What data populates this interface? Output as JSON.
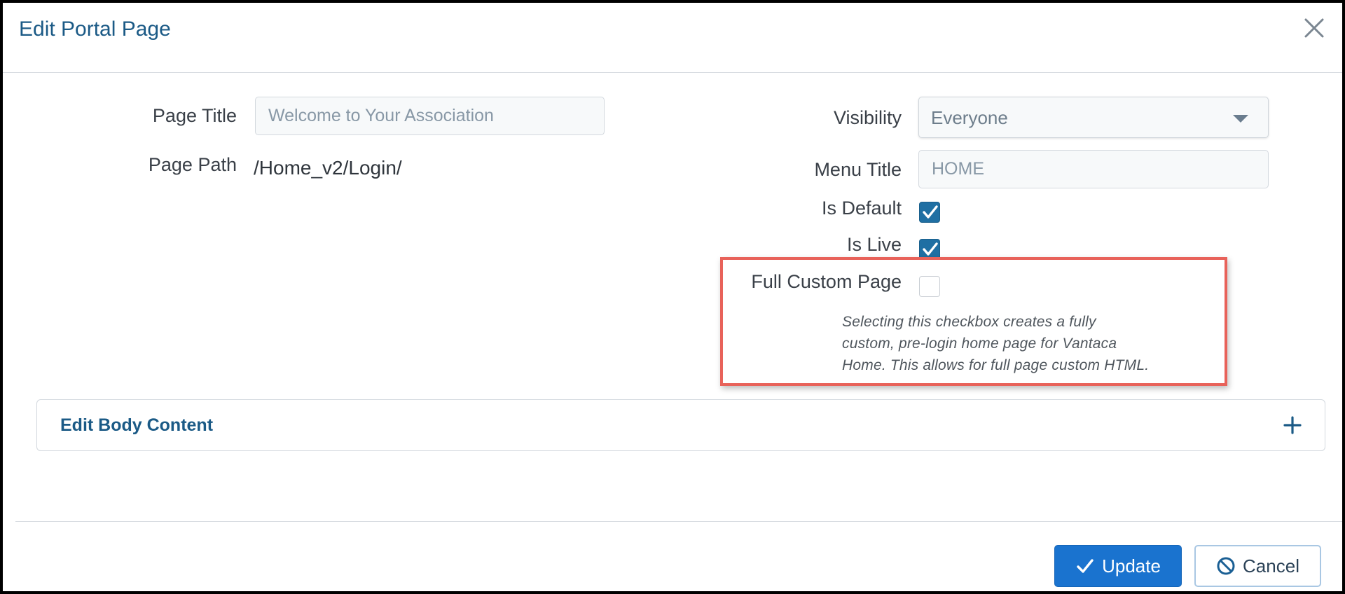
{
  "modal": {
    "title": "Edit Portal Page"
  },
  "form": {
    "page_title": {
      "label": "Page Title",
      "placeholder": "Welcome to Your Association"
    },
    "page_path": {
      "label": "Page Path",
      "value": "/Home_v2/Login/"
    },
    "visibility": {
      "label": "Visibility",
      "selected": "Everyone"
    },
    "menu_title": {
      "label": "Menu Title",
      "placeholder": "HOME"
    },
    "is_default": {
      "label": "Is Default",
      "checked": true
    },
    "is_live": {
      "label": "Is Live",
      "checked": true
    },
    "full_custom_page": {
      "label": "Full Custom Page",
      "checked": false,
      "help_line_1": "Selecting this checkbox creates a fully",
      "help_line_2": "custom, pre-login home page for Vantaca",
      "help_line_3": "Home. This allows for full page custom HTML."
    }
  },
  "accordion": {
    "title": "Edit Body Content"
  },
  "footer": {
    "update_label": "Update",
    "cancel_label": "Cancel"
  },
  "colors": {
    "accent": "#1b5a86",
    "primary_button": "#1a73cf",
    "checkbox_checked": "#1f6fa3",
    "highlight": "#e8625a"
  },
  "icons": {
    "close": "close-icon",
    "caret": "caret-down-icon",
    "check": "check-icon",
    "plus": "plus-icon",
    "cancel": "ban-icon"
  }
}
